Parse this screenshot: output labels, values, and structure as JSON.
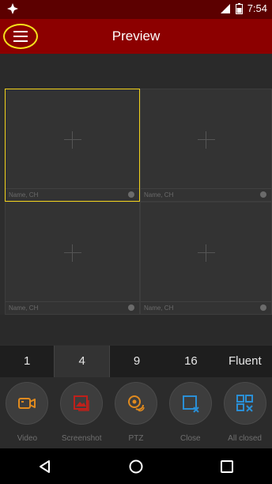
{
  "status_bar": {
    "time": "7:54"
  },
  "header": {
    "title": "Preview"
  },
  "grid": {
    "cells": [
      {
        "label": "Name, CH",
        "selected": true
      },
      {
        "label": "Name, CH",
        "selected": false
      },
      {
        "label": "Name, CH",
        "selected": false
      },
      {
        "label": "Name, CH",
        "selected": false
      }
    ]
  },
  "split_tabs": [
    {
      "label": "1"
    },
    {
      "label": "4",
      "active": true
    },
    {
      "label": "9"
    },
    {
      "label": "16"
    },
    {
      "label": "Fluent"
    }
  ],
  "tools": [
    {
      "label": "Video",
      "icon": "video-icon",
      "color": "#e08a1e"
    },
    {
      "label": "Screenshot",
      "icon": "screenshot-icon",
      "color": "#c0201a"
    },
    {
      "label": "PTZ",
      "icon": "ptz-icon",
      "color": "#e08a1e"
    },
    {
      "label": "Close",
      "icon": "close-window-icon",
      "color": "#2a8fd6"
    },
    {
      "label": "All closed",
      "icon": "all-closed-icon",
      "color": "#2a8fd6"
    }
  ],
  "colors": {
    "status_bar": "#5c0000",
    "title_bar": "#8c0000",
    "selection": "#f2d21b"
  }
}
